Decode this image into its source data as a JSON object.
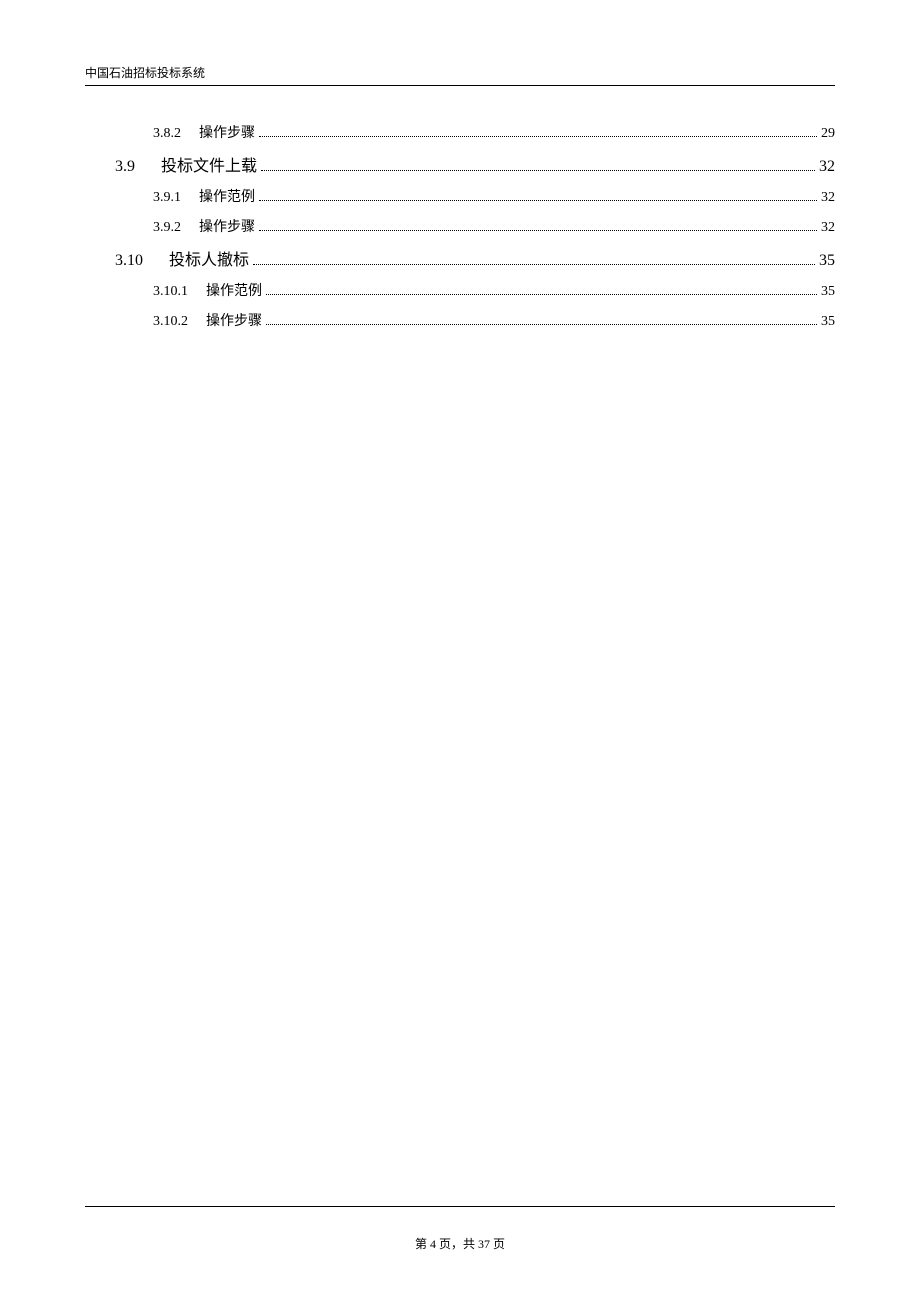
{
  "header": {
    "title": "中国石油招标投标系统"
  },
  "toc": {
    "entries": [
      {
        "level": 2,
        "number": "3.8.2",
        "title": "操作步骤",
        "page": "29"
      },
      {
        "level": 1,
        "number": "3.9",
        "title": "投标文件上载",
        "page": "32"
      },
      {
        "level": 2,
        "number": "3.9.1",
        "title": "操作范例",
        "page": "32"
      },
      {
        "level": 2,
        "number": "3.9.2",
        "title": "操作步骤",
        "page": "32"
      },
      {
        "level": 1,
        "number": "3.10",
        "title": "投标人撤标",
        "page": "35"
      },
      {
        "level": 2,
        "number": "3.10.1",
        "title": "操作范例",
        "page": "35"
      },
      {
        "level": 2,
        "number": "3.10.2",
        "title": "操作步骤",
        "page": "35"
      }
    ]
  },
  "footer": {
    "text": "第 4 页，共 37 页"
  }
}
